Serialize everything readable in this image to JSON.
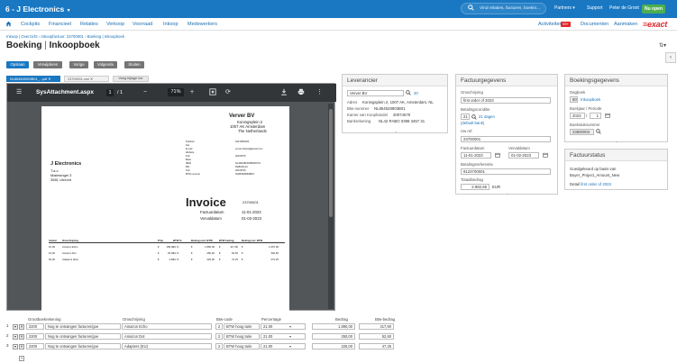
{
  "topbar": {
    "company": "6 - J Electronics",
    "search_placeholder": "Vind relaties, facturen, boekin...",
    "partners": "Partners",
    "support": "Support",
    "user": "Peter de Groot",
    "nu_open": "Nu open"
  },
  "nav": {
    "items": [
      "Cockpits",
      "Financieel",
      "Relaties",
      "Verkoop",
      "Voorraad",
      "Inkoop",
      "Medewerkers"
    ],
    "activiteiten": "Activiteiten",
    "activiteiten_count": "99+",
    "documenten": "Documenten",
    "aanmaken": "Aanmaken",
    "logo": "≡exact"
  },
  "breadcrumb": "Inkoop | Overzicht › Inkoopfactuur: 23700001 › Boeking | Inkoopboek",
  "page_title": {
    "left": "Boeking",
    "sep": "|",
    "right": "Inkoopboek"
  },
  "buttons": {
    "save": "Opslaan",
    "verwijderen": "Verwijderen",
    "vorige": "Vorige",
    "volgende": "Volgende",
    "sluiten": "Sluiten",
    "bijlage": "Voeg bijlage toe"
  },
  "doc_tabs": [
    {
      "label": "NL854528903B01_...pdf ✕",
      "active": true
    },
    {
      "label": "23700001.xml ✕",
      "active": false
    }
  ],
  "viewer": {
    "filename": "SysAttachment.aspx",
    "page": "1",
    "page_total": "/ 1",
    "zoom": "71%"
  },
  "invoice": {
    "supplier": "Verver BV",
    "supplier_address": [
      "Koningsplein 2",
      "1007 AK Amsterdam",
      "The Netherlands"
    ],
    "contact_labels": [
      "Telefoon",
      "Fax",
      "E-mail",
      "Website",
      "KvK",
      "Bank",
      "IBAN",
      "BIC",
      "KvK",
      "BTW nummer"
    ],
    "contact_values": [
      "020 2800000",
      "",
      "verver.inkoop@jexact.com",
      "",
      "20074575",
      "",
      "NL42RABO0398345731",
      "RABONL2U",
      "20074575",
      "NL854528903B01"
    ],
    "customer": "J Electronics",
    "customer_lines": [
      "T.a.v.",
      "Maliesingel 3",
      "3581 Utrecht"
    ],
    "heading": "Invoice",
    "number": "23700001",
    "factuurdatum_label": "Factuurdatum",
    "factuurdatum": "11-01-2023",
    "vervaldatum_label": "Vervaldatum",
    "vervaldatum": "01-02-2023",
    "table_headers": [
      "Aantal",
      "Omschrijving",
      "Prijs",
      "BTW %",
      "Bedrag excl. BTW",
      "BTW bedrag",
      "Bedrag incl. BTW"
    ],
    "table_rows": [
      [
        "10,00",
        "Amazon Echo",
        "€",
        "189,00",
        "21 %",
        "€",
        "1.890,00",
        "€",
        "417,90",
        "€",
        "2.407,90"
      ],
      [
        "10,00",
        "Amazon Dot",
        "€",
        "25,00",
        "21 %",
        "€",
        "250,00",
        "€",
        "52,50",
        "€",
        "302,50"
      ],
      [
        "50,00",
        "Adapters (EU)",
        "€",
        "4,50",
        "21 %",
        "€",
        "225,00",
        "€",
        "47,25",
        "€",
        "272,25"
      ]
    ]
  },
  "leverancier": {
    "title": "Leverancier",
    "name_value": "Verver BV",
    "code": "20",
    "adres_label": "Adres",
    "adres": "Koningsplein 2, 1007 AK, Amsterdam, NL",
    "btw_label": "Btw-nummer",
    "btw": "NL854528903B01",
    "kvk_label": "Kamer van Koophandel",
    "kvk": "20074575",
    "bank_label": "Bankrekening",
    "bank": "NL42 RABO 0398 3457 31"
  },
  "factuurgegevens": {
    "title": "Factuurgegevens",
    "omschrijving_label": "Omschrijving",
    "omschrijving": "first order of 2023",
    "betalingsconditie_label": "Betalingsconditie",
    "betalingsconditie_code": "21",
    "betalingsconditie": "21 dagen",
    "default_bank": "(default bank)",
    "uw_ref_label": "Uw ref.",
    "uw_ref": "23700001",
    "factuurdatum_label": "Factuurdatum",
    "factuurdatum": "11-01-2023",
    "vervaldatum_label": "Vervaldatum",
    "vervaldatum": "01-02-2023",
    "betalingsreferentie_label": "Betalingsreferentie",
    "betalingsreferentie": "9123700001",
    "totaalbedrag_label": "Totaalbedrag",
    "totaalbedrag": "2.982,65",
    "currency": "EUR"
  },
  "boekingsgegevens": {
    "title": "Boekingsgegevens",
    "dagboek_label": "Dagboek",
    "dagboek_code": "60",
    "dagboek": "Inkoopboek",
    "boekjaar_label": "Boekjaar / Periode",
    "boekjaar": "2023",
    "periode": "1",
    "boekstuk_label": "Boekstuknummer",
    "boekstuk": "23600004"
  },
  "factuurstatus": {
    "title": "Factuurstatus",
    "line1": "Goedgekeurd op basis van",
    "line2": "Buyer_Project_Amount_New",
    "detail_label": "Detail",
    "detail_link": "first order of 2023"
  },
  "grid": {
    "headers": [
      "Grootboekrekening",
      "Omschrijving",
      "Btw-code",
      "Percentage",
      "Bedrag",
      "Btw-bedrag"
    ],
    "rows": [
      {
        "no": "1",
        "gb_code": "2200",
        "gb_name": "Nog te ontvangen facturen/goe",
        "desc": "Amazon Echo",
        "btw_code": "2",
        "btw_name": "BTW hoog tarie",
        "pct": "21.00",
        "amount": "1.890,00",
        "btw": "417,90"
      },
      {
        "no": "2",
        "gb_code": "2200",
        "gb_name": "Nog te ontvangen facturen/goe",
        "desc": "Amazon Dot",
        "btw_code": "2",
        "btw_name": "BTW hoog tarie",
        "pct": "21.00",
        "amount": "250,00",
        "btw": "52,50"
      },
      {
        "no": "3",
        "gb_code": "2200",
        "gb_name": "Nog te ontvangen facturen/goe",
        "desc": "Adapters (EU)",
        "btw_code": "2",
        "btw_name": "BTW hoog tarie",
        "pct": "21.00",
        "amount": "225,00",
        "btw": "47,25"
      }
    ]
  }
}
